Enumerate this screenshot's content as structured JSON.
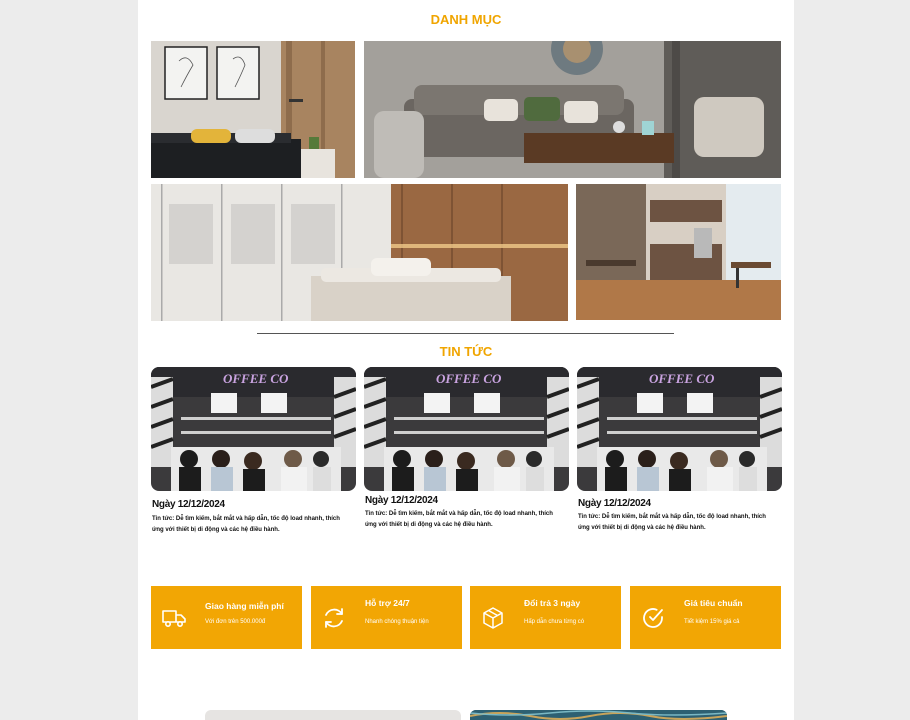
{
  "categories": {
    "title": "DANH MỤC",
    "images": [
      {
        "icon": "bedroom-photo"
      },
      {
        "icon": "living-room-photo"
      },
      {
        "icon": "wardrobe-bedroom-photo"
      },
      {
        "icon": "kitchen-apartment-photo"
      }
    ]
  },
  "news": {
    "title": "TIN TỨC",
    "items": [
      {
        "date": "Ngày 12/12/2024",
        "text": "Tin tức: Dễ tìm kiếm, bắt mắt và hấp dẫn, tốc độ load nhanh, thích ứng với thiết bị di động và các hệ điều hành.",
        "image_sign": "OFFEE CO"
      },
      {
        "date": "Ngày 12/12/2024",
        "text": "Tin tức: Dễ tìm kiếm, bắt mắt và hấp dẫn, tốc độ load nhanh, thích ứng với thiết bị di động và các hệ điều hành.",
        "image_sign": "OFFEE CO"
      },
      {
        "date": "Ngày 12/12/2024",
        "text": "Tin tức: Dễ tìm kiếm, bắt mắt và hấp dẫn, tốc độ load nhanh, thích ứng với thiết bị di động và các hệ điều hành.",
        "image_sign": "OFFEE CO"
      }
    ]
  },
  "features": [
    {
      "icon": "truck-icon",
      "title": "Giao hàng miễn phí",
      "subtitle": "Với đơn trên 500.000đ"
    },
    {
      "icon": "refresh-icon",
      "title": "Hỗ trợ 24/7",
      "subtitle": "Nhanh chóng thuận tiện"
    },
    {
      "icon": "box-icon",
      "title": "Đổi trả 3 ngày",
      "subtitle": "Hấp dẫn chưa từng có"
    },
    {
      "icon": "check-circle-icon",
      "title": "Giá tiêu chuẩn",
      "subtitle": "Tiết kiệm 15% giá cả"
    }
  ],
  "colors": {
    "accent": "#f0a500",
    "feature_bg": "#f2a604",
    "page_bg": "#ececec"
  }
}
